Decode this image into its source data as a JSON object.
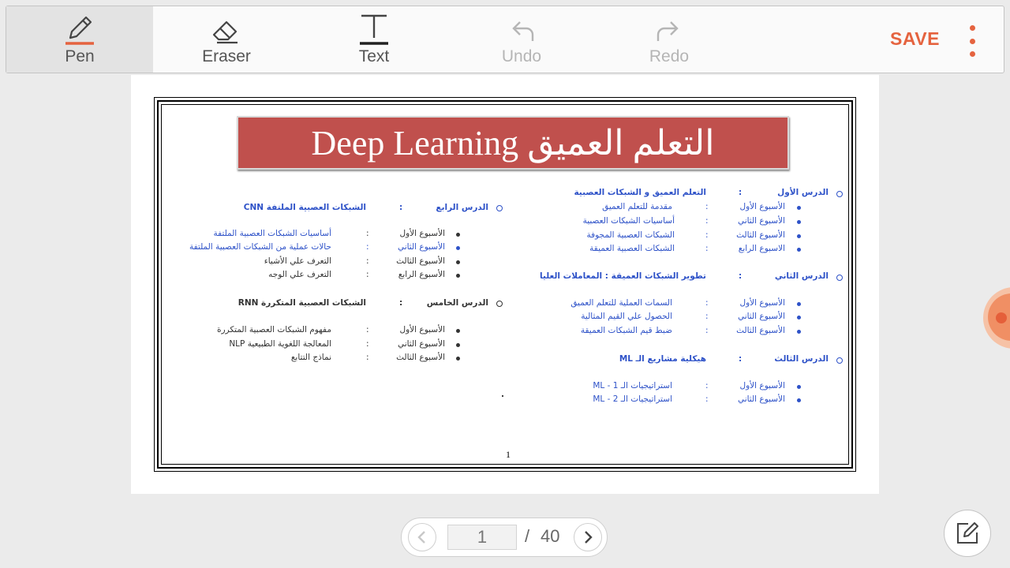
{
  "toolbar": {
    "pen_label": "Pen",
    "eraser_label": "Eraser",
    "text_label": "Text",
    "undo_label": "Undo",
    "redo_label": "Redo",
    "save_label": "SAVE",
    "accent_color": "#e5633f",
    "icons": [
      "pen-icon",
      "eraser-icon",
      "text-icon",
      "undo-icon",
      "redo-icon",
      "more-vert-icon"
    ]
  },
  "document": {
    "title": "Deep Learning التعلم العميق",
    "banner_color": "#c0504d",
    "page_number": "1",
    "right_column": {
      "lesson1": {
        "label": "الدرس الأول",
        "colon": ":",
        "title": "التعلم العميق و الشبكات العصبية",
        "weeks": [
          {
            "week": "الأسبوع الأول",
            "colon": ":",
            "topic": "مقدمة للتعلم العميق"
          },
          {
            "week": "الأسبوع الثاني",
            "colon": ":",
            "topic": "أساسيات الشبكات العصبية"
          },
          {
            "week": "الأسبوع الثالث",
            "colon": ":",
            "topic": "الشبكات العصبية المجوفة"
          },
          {
            "week": "الاسبوع الرابع",
            "colon": ":",
            "topic": "الشبكات العصبية العميقة"
          }
        ]
      },
      "lesson2": {
        "label": "الدرس الثاني",
        "colon": ":",
        "title": "تطوير الشبكات العميقة : المعاملات العليا",
        "weeks": [
          {
            "week": "الأسبوع الأول",
            "colon": ":",
            "topic": "السمات العملية للتعلم العميق"
          },
          {
            "week": "الأسبوع الثاني",
            "colon": ":",
            "topic": "الحصول علي القيم المثالية"
          },
          {
            "week": "الأسبوع الثالث",
            "colon": ":",
            "topic": "ضبط قيم الشبكات العميقة"
          }
        ]
      },
      "lesson3": {
        "label": "الدرس الثالث",
        "colon": ":",
        "title": "هيكلية مشاريع الـ ML",
        "weeks": [
          {
            "week": "الأسبوع الأول",
            "colon": ":",
            "topic": "استراتيجيات الـ  ML - 1"
          },
          {
            "week": "الأسبوع الثاني",
            "colon": ":",
            "topic": "استراتيجيات الـ  ML - 2"
          }
        ]
      }
    },
    "left_column": {
      "lesson4": {
        "label": "الدرس الرابع",
        "colon": ":",
        "title": "الشبكات العصبية الملتفة CNN",
        "weeks": [
          {
            "week": "الأسبوع الأول",
            "colon": ":",
            "topic": "أساسيات الشبكات العصبية الملتفة"
          },
          {
            "week": "الأسبوع الثاني",
            "colon": ":",
            "topic": "حالات عملية من الشبكات العصبية الملتفة"
          },
          {
            "week": "الأسبوع الثالث",
            "colon": ":",
            "topic": "التعرف علي الأشياء"
          },
          {
            "week": "الأسبوع الرابع",
            "colon": ":",
            "topic": "التعرف علي الوجه"
          }
        ]
      },
      "lesson5": {
        "label": "الدرس الخامس",
        "colon": ":",
        "title": "الشبكات العصبية المتكررة RNN",
        "weeks": [
          {
            "week": "الأسبوع الأول",
            "colon": ":",
            "topic": "مفهوم الشبكات العصبية المتكررة"
          },
          {
            "week": "الأسبوع الثاني",
            "colon": ":",
            "topic": "المعالجة اللغوية الطبيعية NLP"
          },
          {
            "week": "الأسبوع الثالث",
            "colon": ":",
            "topic": "نماذج التتابع"
          }
        ]
      }
    }
  },
  "pager": {
    "current_page": "1",
    "separator": "/",
    "total_pages": "40"
  }
}
